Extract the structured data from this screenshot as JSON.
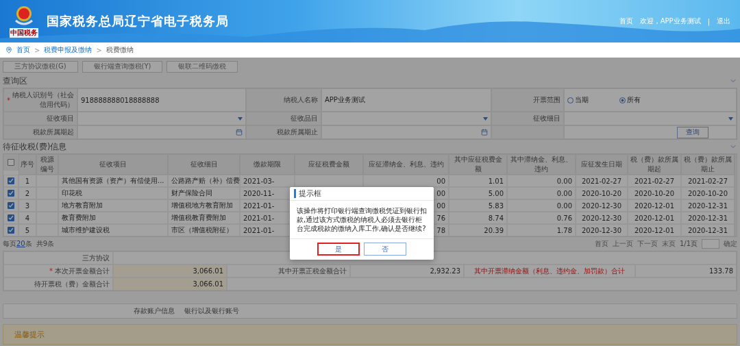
{
  "header": {
    "title": "国家税务总局辽宁省电子税务局",
    "logo_caption": "中国税务",
    "links": [
      {
        "label": "首页"
      },
      {
        "label": "欢迎，APP业务测试"
      },
      {
        "label": "退出"
      }
    ],
    "separator": "|"
  },
  "breadcrumb": {
    "separator": ">",
    "items": [
      {
        "label": "首页",
        "current": false
      },
      {
        "label": "税费申报及缴纳",
        "current": false
      },
      {
        "label": "税费缴纳",
        "current": true
      }
    ]
  },
  "actions": [
    "三方协议缴税(G)",
    "银行端查询缴税(Y)",
    "银联二维码缴税"
  ],
  "query": {
    "title": "查询区",
    "required_mark": "*",
    "fields": [
      {
        "kind": "text",
        "label": "纳税人识别号（社会信用代码）",
        "required": true,
        "value": "918888888018888888"
      },
      {
        "kind": "text",
        "label": "纳税人名称",
        "required": false,
        "value": "APP业务测试"
      },
      {
        "kind": "radio",
        "label": "开票范围",
        "required": false,
        "options": [
          {
            "label": "当期",
            "selected": false
          },
          {
            "label": "所有",
            "selected": true
          }
        ]
      },
      {
        "kind": "select",
        "label": "征收项目",
        "required": false
      },
      {
        "kind": "select",
        "label": "征收品目",
        "required": false
      },
      {
        "kind": "select",
        "label": "征收细目",
        "required": false
      },
      {
        "kind": "date",
        "label": "税款所属期起",
        "required": false
      },
      {
        "kind": "date",
        "label": "税款所属期止",
        "required": false
      },
      {
        "kind": "button",
        "label": "查询"
      }
    ]
  },
  "table": {
    "title": "待征收税(费)信息",
    "all_checked": false,
    "columns": [
      "序号",
      "税源编号",
      "征收项目",
      "征收细目",
      "缴款期限",
      "应征税费金额",
      "应征滞纳金、利息、违约",
      "其中应征税费金额",
      "其中滞纳金、利息、违约",
      "应征发生日期",
      "税（费）款所属期起",
      "税（费）款所属期止"
    ],
    "rows": [
      {
        "checked": true,
        "no": "1",
        "item": "其他国有资源（资产）有偿使用...",
        "detail": "公路路产赔（补）偿费",
        "deadline": "2021-03-",
        "late_fee": "00",
        "tax_amount": "1.01",
        "late_amount": "0.00",
        "date": "2021-02-27",
        "start": "2021-02-27",
        "end": "2021-02-27"
      },
      {
        "checked": true,
        "no": "2",
        "item": "印花税",
        "detail": "财产保险合同",
        "deadline": "2020-11-",
        "late_fee": "00",
        "tax_amount": "5.00",
        "late_amount": "0.00",
        "date": "2020-10-20",
        "start": "2020-10-20",
        "end": "2020-10-20"
      },
      {
        "checked": true,
        "no": "3",
        "item": "地方教育附加",
        "detail": "增值税地方教育附加",
        "deadline": "2021-01-",
        "late_fee": "00",
        "tax_amount": "5.83",
        "late_amount": "0.00",
        "date": "2020-12-30",
        "start": "2020-12-01",
        "end": "2020-12-31"
      },
      {
        "checked": true,
        "no": "4",
        "item": "教育费附加",
        "detail": "增值税教育费附加",
        "deadline": "2021-01-",
        "late_fee": "76",
        "tax_amount": "8.74",
        "late_amount": "0.76",
        "date": "2020-12-30",
        "start": "2020-12-01",
        "end": "2020-12-31"
      },
      {
        "checked": true,
        "no": "5",
        "item": "城市维护建设税",
        "detail": "市区（增值税附征）",
        "deadline": "2021-01-",
        "late_fee": "78",
        "tax_amount": "20.39",
        "late_amount": "1.78",
        "date": "2020-12-30",
        "start": "2020-12-01",
        "end": "2020-12-31"
      }
    ]
  },
  "pagination": {
    "prefix": "每页",
    "page_size": "20",
    "suffix": "条",
    "total": "共9条",
    "links": [
      "首页",
      "上一页",
      "下一页",
      "末页"
    ],
    "page_info": "1/1页",
    "go": "确定"
  },
  "summary": {
    "protocol_label": "三方协议",
    "required_mark": "*",
    "total_label": "本次开票金额合计",
    "total_value": "3,066.01",
    "tax_label": "其中开票正税金额合计",
    "tax_value": "2,932.23",
    "late_label": "其中开票滞纳金额（利息、违约金、加罚款）合计",
    "late_value": "133.78",
    "pending_label": "待开票税（费）金额合计",
    "pending_value": "3,066.01"
  },
  "account": {
    "label": "存款账户信息",
    "bank_label": "银行以及银行账号"
  },
  "tip": {
    "title": "温馨提示"
  },
  "dialog": {
    "title": "提示框",
    "message": "该操作将打印银行端查询缴税凭证到银行扣款,通过该方式缴税的纳税人必须去银行柜台完成税款的缴纳入库工作,确认是否继续?",
    "buttons": [
      {
        "label": "是",
        "highlighted": true
      },
      {
        "label": "否",
        "highlighted": false
      }
    ]
  }
}
